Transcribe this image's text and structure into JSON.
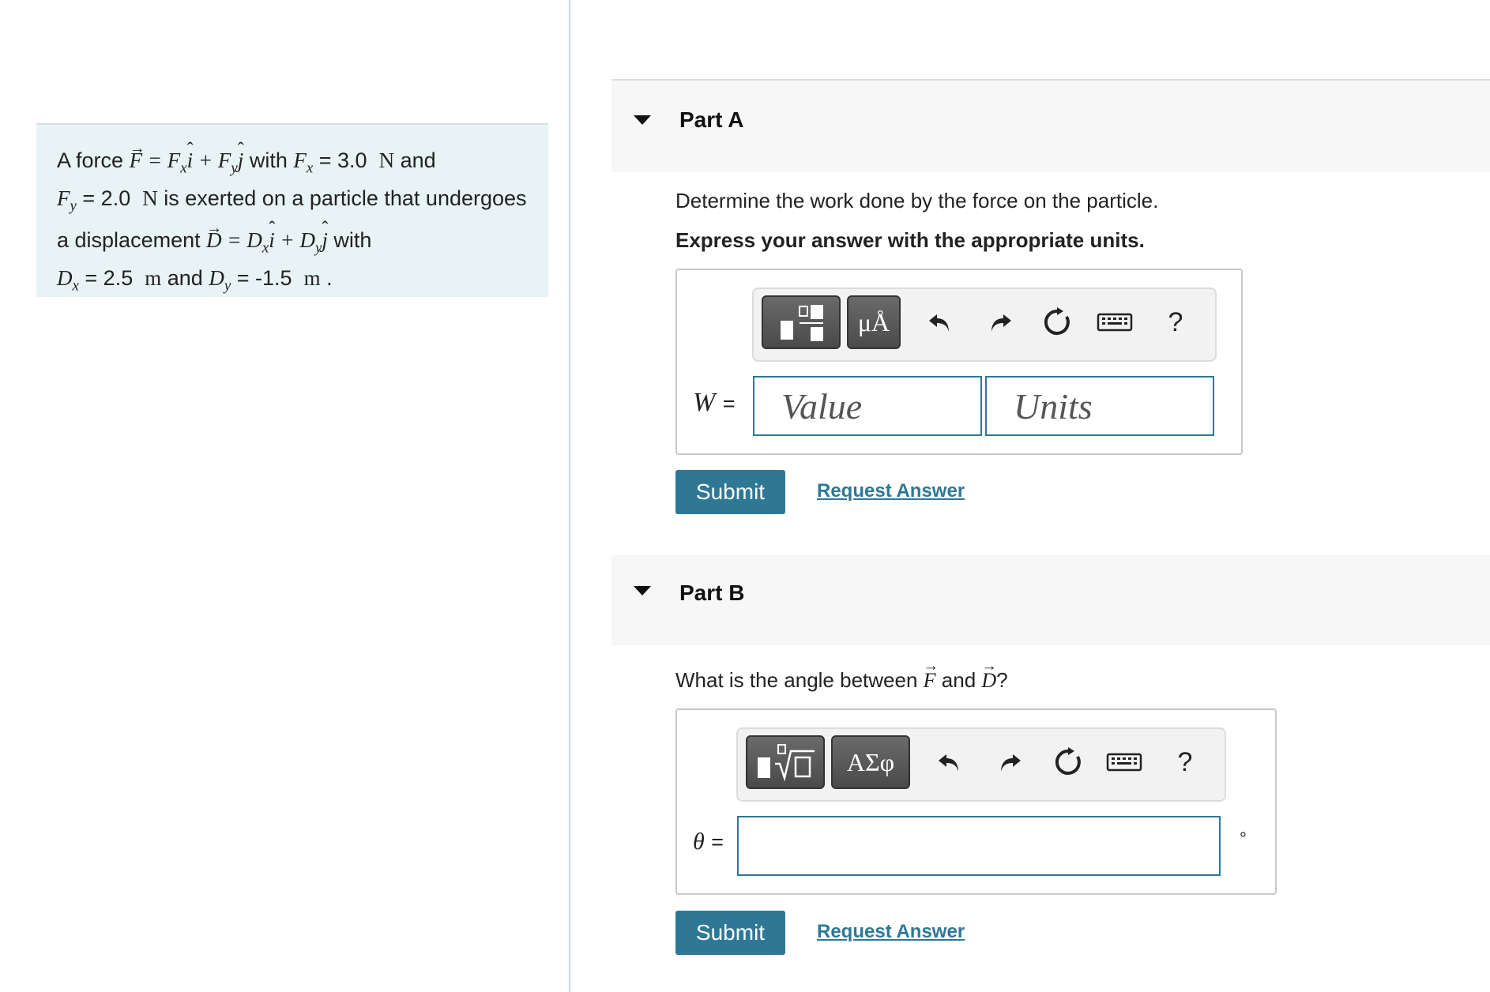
{
  "problem": {
    "t1": "A force",
    "t2": "with",
    "fx_value": "= 3.0",
    "unit_N": "N",
    "t3": "and",
    "fy_value": "= 2.0",
    "t4": "is exerted on a particle that undergoes",
    "t5": "a displacement",
    "t6": "with",
    "dx_value": "= 2.5",
    "unit_m": "m",
    "t7": "and",
    "dy_value": "= -1.5",
    "period": "."
  },
  "partA": {
    "title": "Part A",
    "instruction": "Determine the work done by the force on the particle.",
    "instruction_bold": "Express your answer with the appropriate units.",
    "toolbar_units_symbol": "μÅ",
    "toolbar_help": "?",
    "var_label": "W",
    "equals": "=",
    "value_placeholder": "Value",
    "units_placeholder": "Units",
    "submit_label": "Submit",
    "request_label": "Request Answer"
  },
  "partB": {
    "title": "Part B",
    "instruction_pre": "What is the angle between",
    "instruction_and": "and",
    "instruction_post": "?",
    "toolbar_greek_symbol": "ΑΣφ",
    "toolbar_help": "?",
    "var_label": "θ",
    "equals": "=",
    "unit_suffix": "°",
    "submit_label": "Submit",
    "request_label": "Request Answer"
  },
  "colors": {
    "accent": "#2e7896",
    "problem_bg": "#e8f3f5",
    "header_bg": "#f7f7f7",
    "divider": "#c9d6e3"
  },
  "icons": [
    "caret-down-icon",
    "template-icon",
    "undo-icon",
    "redo-icon",
    "reset-icon",
    "keyboard-icon",
    "help-icon",
    "sqrt-template-icon"
  ]
}
